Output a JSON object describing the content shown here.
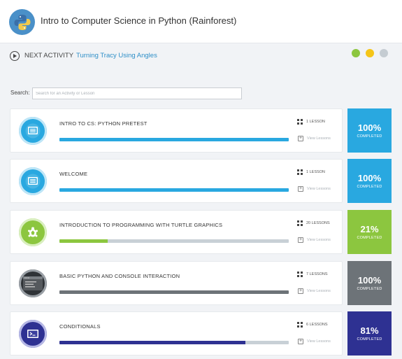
{
  "header": {
    "course_title": "Intro to Computer Science in Python (Rainforest)"
  },
  "next_activity": {
    "label": "NEXT ACTIVITY",
    "link": "Turning Tracy Using Angles"
  },
  "status_dots": [
    "#8cc63f",
    "#f5c518",
    "#c5ccd2"
  ],
  "search": {
    "label": "Search:",
    "placeholder": "Search for an Activity or Lesson"
  },
  "modules": [
    {
      "title": "INTRO TO CS: PYTHON PRETEST",
      "lessons": "1 LESSON",
      "view": "View Lessons",
      "percent": "100%",
      "completed_label": "COMPLETED",
      "progress": 1.0,
      "color": "#29a8e0",
      "icon": "monitor-icon"
    },
    {
      "title": "WELCOME",
      "lessons": "1 LESSON",
      "view": "View Lessons",
      "percent": "100%",
      "completed_label": "COMPLETED",
      "progress": 1.0,
      "color": "#29a8e0",
      "icon": "monitor-icon"
    },
    {
      "title": "INTRODUCTION TO PROGRAMMING WITH TURTLE GRAPHICS",
      "lessons": "20 LESSONS",
      "view": "View Lessons",
      "percent": "21%",
      "completed_label": "COMPLETED",
      "progress": 0.21,
      "color": "#8cc63f",
      "icon": "turtle-icon"
    },
    {
      "title": "BASIC PYTHON AND CONSOLE INTERACTION",
      "lessons": "7 LESSONS",
      "view": "View Lessons",
      "percent": "100%",
      "completed_label": "COMPLETED",
      "progress": 1.0,
      "color": "#6d7378",
      "icon": "console-icon"
    },
    {
      "title": "CONDITIONALS",
      "lessons": "6 LESSONS",
      "view": "View Lessons",
      "percent": "81%",
      "completed_label": "COMPLETED",
      "progress": 0.81,
      "color": "#2e3192",
      "icon": "terminal-icon"
    }
  ]
}
